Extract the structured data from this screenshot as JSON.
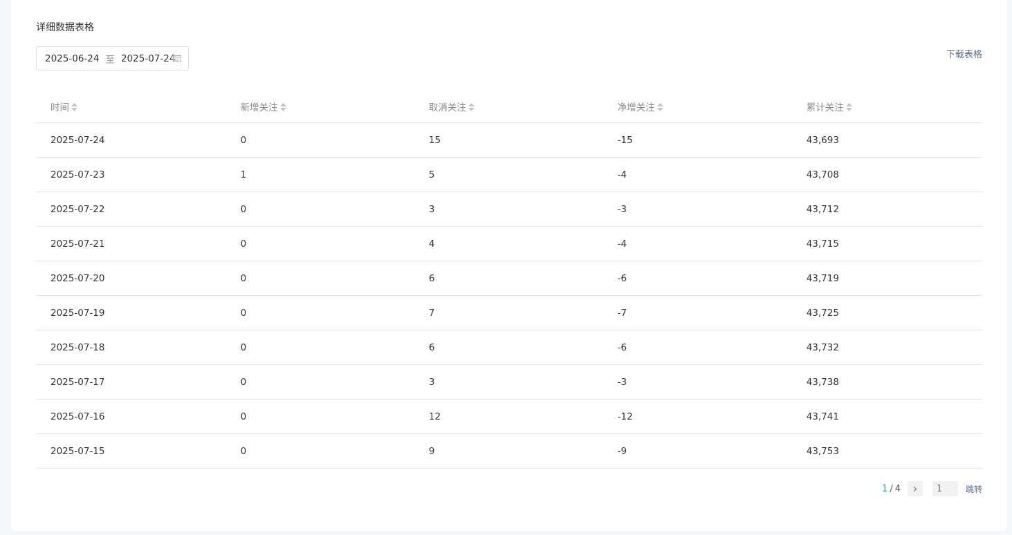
{
  "section": {
    "title": "详细数据表格",
    "download_label": "下载表格"
  },
  "date_range": {
    "start": "2025-06-24",
    "separator": "至",
    "end": "2025-07-24"
  },
  "table": {
    "headers": [
      "时间",
      "新增关注",
      "取消关注",
      "净增关注",
      "累计关注"
    ],
    "rows": [
      [
        "2025-07-24",
        "0",
        "15",
        "-15",
        "43,693"
      ],
      [
        "2025-07-23",
        "1",
        "5",
        "-4",
        "43,708"
      ],
      [
        "2025-07-22",
        "0",
        "3",
        "-3",
        "43,712"
      ],
      [
        "2025-07-21",
        "0",
        "4",
        "-4",
        "43,715"
      ],
      [
        "2025-07-20",
        "0",
        "6",
        "-6",
        "43,719"
      ],
      [
        "2025-07-19",
        "0",
        "7",
        "-7",
        "43,725"
      ],
      [
        "2025-07-18",
        "0",
        "6",
        "-6",
        "43,732"
      ],
      [
        "2025-07-17",
        "0",
        "3",
        "-3",
        "43,738"
      ],
      [
        "2025-07-16",
        "0",
        "12",
        "-12",
        "43,741"
      ],
      [
        "2025-07-15",
        "0",
        "9",
        "-9",
        "43,753"
      ]
    ]
  },
  "pagination": {
    "current": "1",
    "separator": "/",
    "total": "4",
    "jump_placeholder": "1",
    "jump_label": "跳转"
  },
  "colors": {
    "accent_green": "#07c160",
    "link_blue": "#576b95"
  },
  "icons": {
    "calendar": "calendar-icon",
    "sort": "sort-icon",
    "next": "chevron-right-icon"
  }
}
